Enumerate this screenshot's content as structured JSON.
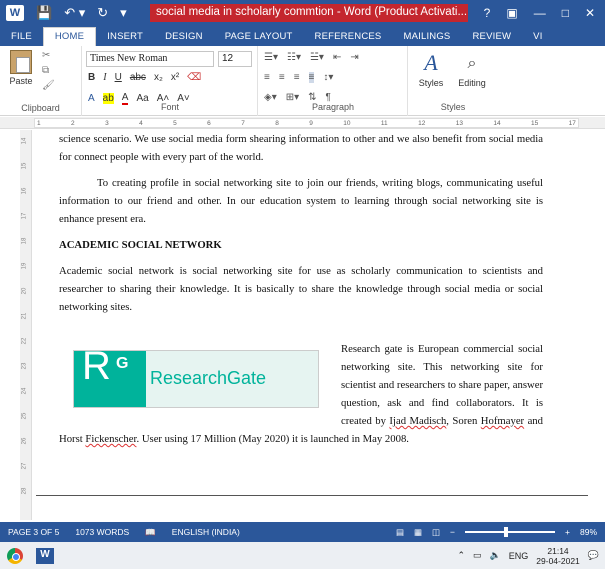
{
  "window": {
    "title": "social media in scholarly commtion - Word (Product Activati...",
    "help": "?",
    "minimize": "—",
    "restore": "□",
    "close": "✕"
  },
  "qat": {
    "save": "💾",
    "undo": "↶ ▾",
    "redo": "↻",
    "more": "▾"
  },
  "tabs": [
    "FILE",
    "HOME",
    "INSERT",
    "DESIGN",
    "PAGE LAYOUT",
    "REFERENCES",
    "MAILINGS",
    "REVIEW",
    "VI"
  ],
  "ribbon": {
    "paste_label": "Paste",
    "clipboard_label": "Clipboard",
    "font_name": "Times New Roman",
    "font_size": "12",
    "font_label": "Font",
    "paragraph_label": "Paragraph",
    "styles_label": "Styles",
    "editing_label": "Editing",
    "bold": "B",
    "italic": "I",
    "underline": "U",
    "strike": "abc",
    "subscript": "x₂",
    "superscript": "x²",
    "font_color": "A",
    "highlight": "ab",
    "text_effects": "A",
    "change_case": "Aa",
    "grow_font": "A˄",
    "shrink_font": "A˅",
    "pilcrow": "¶"
  },
  "ruler_ticks": [
    "1",
    "2",
    "3",
    "4",
    "5",
    "6",
    "7",
    "8",
    "9",
    "10",
    "11",
    "12",
    "13",
    "14",
    "15",
    "17"
  ],
  "vruler_ticks": [
    "14",
    "15",
    "16",
    "17",
    "18",
    "19",
    "20",
    "21",
    "22",
    "23",
    "24",
    "25",
    "26",
    "27",
    "28"
  ],
  "document": {
    "p1": "science scenario. We use social media form shearing information to other and we also benefit from social media for connect people with every part of the world.",
    "p2": "To creating profile in social networking site to join our friends, writing blogs, communicating useful information to our friend and other. In our education system to learning through social networking site is enhance present era.",
    "heading": "ACADEMIC SOCIAL NETWORK",
    "p3": "Academic social network is social networking site for use as scholarly communication to scientists and researcher to sharing their knowledge. It is basically to share the knowledge through social media or social networking sites.",
    "rg_r": "R",
    "rg_g": "G",
    "rg_name": "ResearchGate",
    "p4_a": "Research gate is European commercial social networking site. This networking site for scientist and researchers to share paper, answer question, ask and find collaborators. It is created by ",
    "p4_name1": "Ijad Madisch",
    "p4_b": ", Soren ",
    "p4_name2": "Hofmayer",
    "p4_c": " and Horst ",
    "p4_name3": "Fickenscher",
    "p4_d": ". User using 17 Million (May 2020) it is launched in May 2008."
  },
  "status": {
    "page": "PAGE 3 OF 5",
    "words": "1073 WORDS",
    "language": "ENGLISH (INDIA)",
    "zoom": "89%",
    "zoom_minus": "−",
    "zoom_plus": "+"
  },
  "zoom_fraction": 0.45,
  "taskbar": {
    "tray_arrow": "⌃",
    "lang": "ENG",
    "time": "21:14",
    "date": "29-04-2021"
  },
  "colors": {
    "word_blue": "#2b579a",
    "rg_green": "#00b39b",
    "title_red": "#c4262e"
  }
}
